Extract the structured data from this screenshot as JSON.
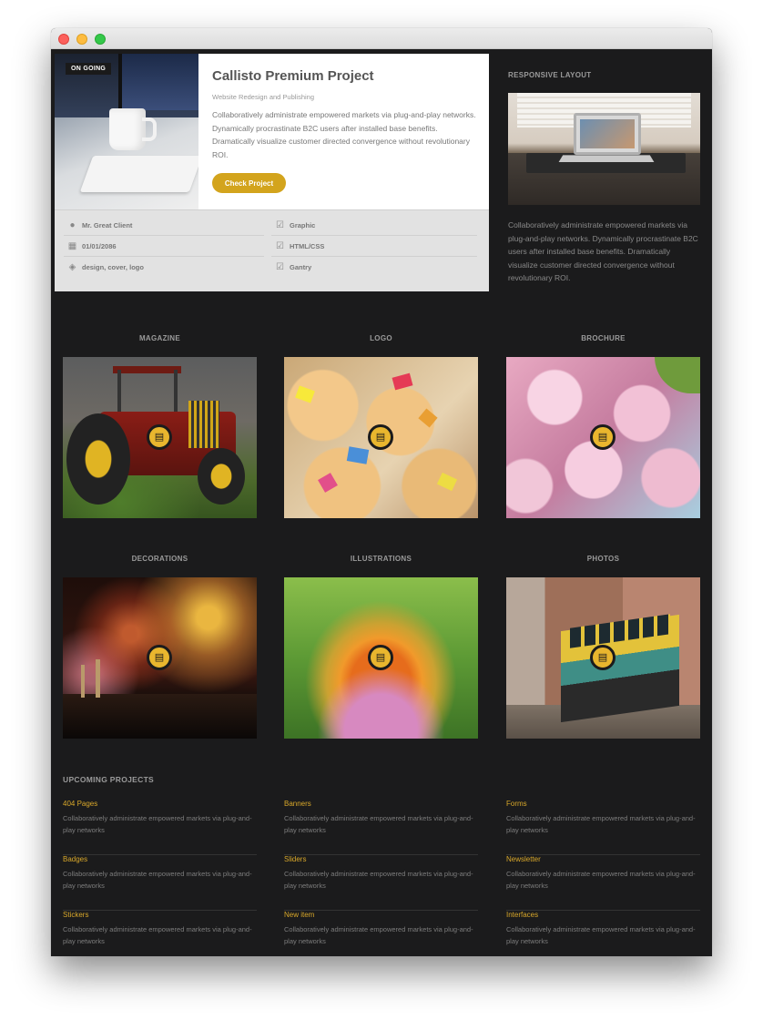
{
  "featured": {
    "badge": "ON GOING",
    "title": "Callisto Premium Project",
    "subtitle": "Website Redesign and Publishing",
    "description": "Collaboratively administrate empowered markets via plug-and-play networks. Dynamically procrastinate B2C users after installed base benefits. Dramatically visualize customer directed convergence without revolutionary ROI.",
    "button_label": "Check Project",
    "meta_left": [
      {
        "icon": "user-icon",
        "text": "Mr. Great Client"
      },
      {
        "icon": "calendar-icon",
        "text": "01/01/2086"
      },
      {
        "icon": "tag-icon",
        "text": "design, cover, logo"
      }
    ],
    "meta_right": [
      {
        "icon": "checkbox-icon",
        "text": "Graphic"
      },
      {
        "icon": "checkbox-icon",
        "text": "HTML/CSS"
      },
      {
        "icon": "checkbox-icon",
        "text": "Gantry"
      }
    ]
  },
  "responsive": {
    "title": "RESPONSIVE LAYOUT",
    "description": "Collaboratively administrate empowered markets via plug-and-play networks. Dynamically procrastinate B2C users after installed base benefits. Dramatically visualize customer directed convergence without revolutionary ROI."
  },
  "gallery": [
    {
      "label": "MAGAZINE",
      "icon": "document-icon"
    },
    {
      "label": "LOGO",
      "icon": "document-icon"
    },
    {
      "label": "BROCHURE",
      "icon": "document-icon"
    },
    {
      "label": "DECORATIONS",
      "icon": "document-icon"
    },
    {
      "label": "ILLUSTRATIONS",
      "icon": "document-icon"
    },
    {
      "label": "PHOTOS",
      "icon": "document-icon"
    }
  ],
  "upcoming": {
    "title": "UPCOMING PROJECTS",
    "items": [
      {
        "name": "404 Pages",
        "desc": "Collaboratively administrate empowered markets via plug-and-play networks"
      },
      {
        "name": "Banners",
        "desc": "Collaboratively administrate empowered markets via plug-and-play networks"
      },
      {
        "name": "Forms",
        "desc": "Collaboratively administrate empowered markets via plug-and-play networks"
      },
      {
        "name": "Badges",
        "desc": "Collaboratively administrate empowered markets via plug-and-play networks"
      },
      {
        "name": "Sliders",
        "desc": "Collaboratively administrate empowered markets via plug-and-play networks"
      },
      {
        "name": "Newsletter",
        "desc": "Collaboratively administrate empowered markets via plug-and-play networks"
      },
      {
        "name": "Stickers",
        "desc": "Collaboratively administrate empowered markets via plug-and-play networks"
      },
      {
        "name": "New item",
        "desc": "Collaboratively administrate empowered markets via plug-and-play networks"
      },
      {
        "name": "Interfaces",
        "desc": "Collaboratively administrate empowered markets via plug-and-play networks"
      }
    ]
  },
  "colors": {
    "accent": "#d3a41d",
    "background": "#1b1b1c",
    "link": "#d9a82a"
  }
}
